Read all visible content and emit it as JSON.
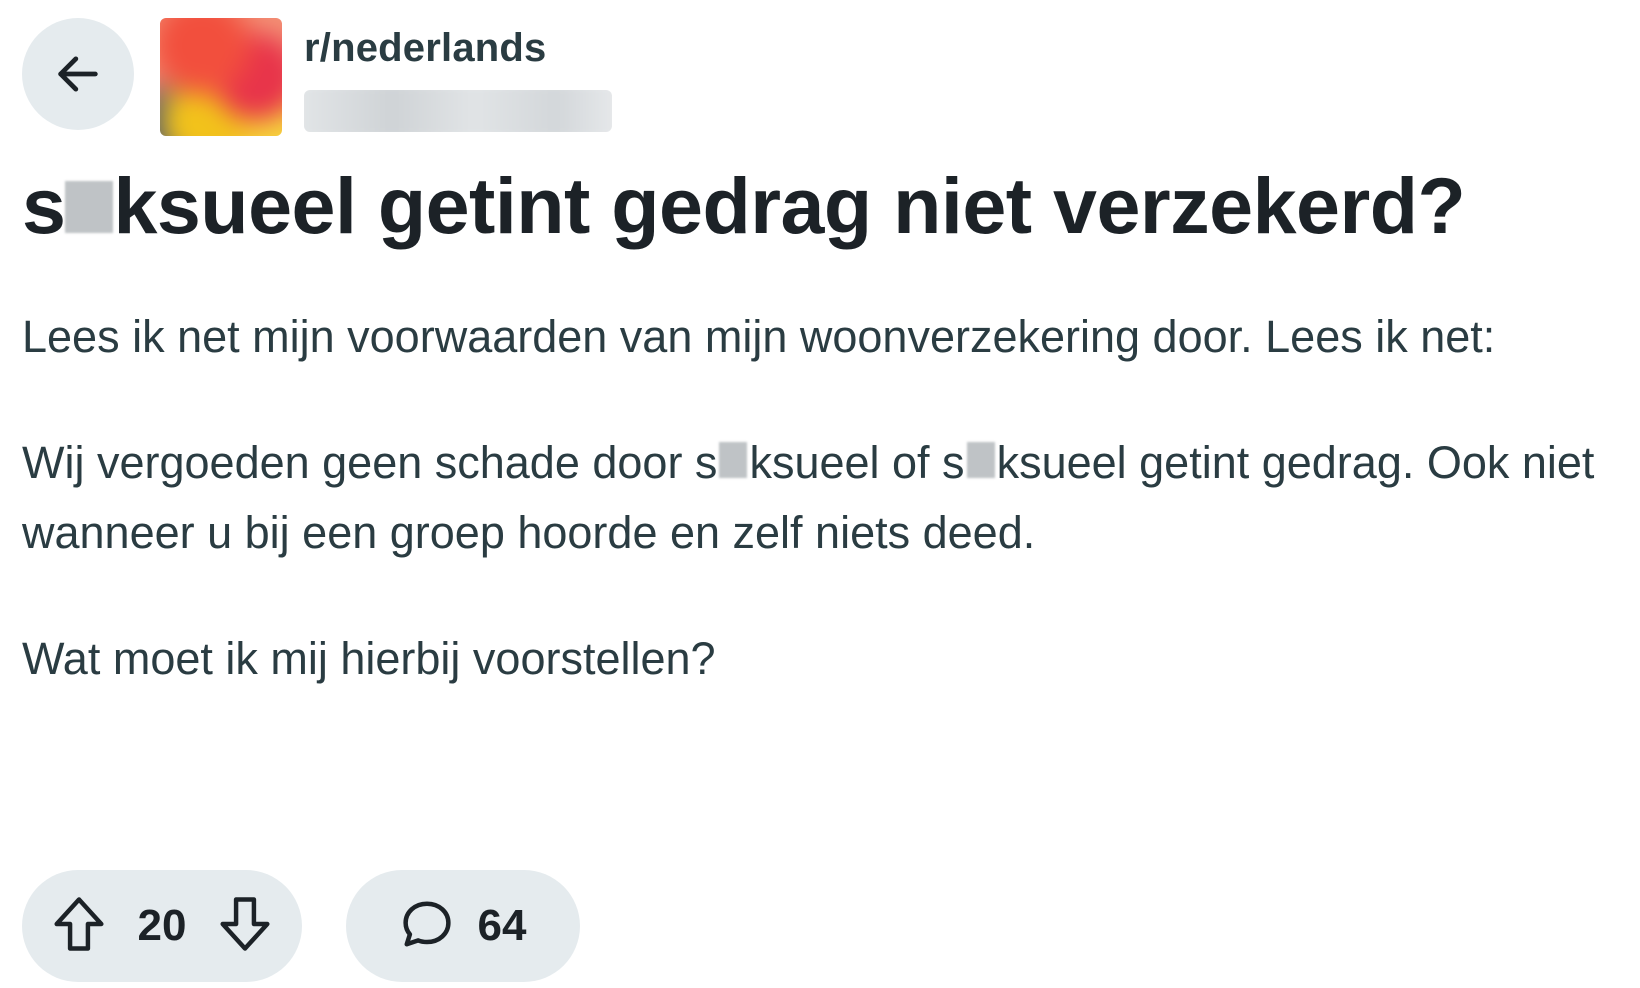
{
  "header": {
    "back_icon": "arrow-left-icon",
    "subreddit": "r/nederlands"
  },
  "post": {
    "title_before": "s",
    "title_after": "ksueel getint gedrag niet verzekerd?",
    "paragraph1": "Lees ik net mijn voorwaarden van mijn woonverzekering door. Lees ik net:",
    "paragraph2_part1": "Wij vergoeden geen schade door s",
    "paragraph2_part2": "ksueel of s",
    "paragraph2_part3": "ksueel getint gedrag. Ook niet wanneer u bij een groep hoorde en zelf niets deed.",
    "paragraph3": "Wat moet ik mij hierbij voorstellen?"
  },
  "actions": {
    "upvote_icon": "arrow-up-outline-icon",
    "downvote_icon": "arrow-down-outline-icon",
    "vote_count": "20",
    "comment_icon": "speech-bubble-icon",
    "comment_count": "64"
  },
  "colors": {
    "pill_background": "#e5ebee",
    "text_primary": "#1c2227",
    "text_body": "#2a3c42"
  }
}
